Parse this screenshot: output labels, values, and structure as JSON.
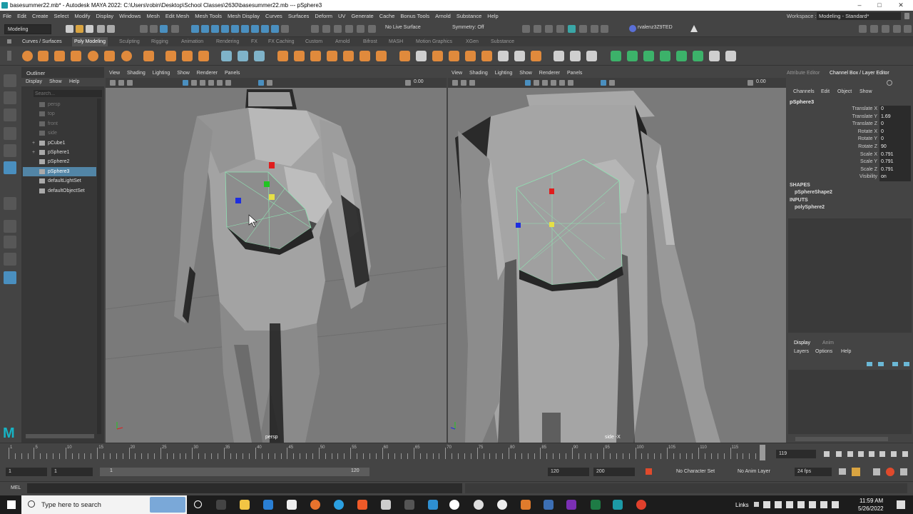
{
  "titlebar": {
    "title": "basesummer22.mb* - Autodesk MAYA 2022: C:\\Users\\robin\\Desktop\\School Classes\\2630\\basesummer22.mb   ---   pSphere3"
  },
  "menubar": {
    "items": [
      "File",
      "Edit",
      "Create",
      "Select",
      "Modify",
      "Display",
      "Windows",
      "Mesh",
      "Edit Mesh",
      "Mesh Tools",
      "Mesh Display",
      "Curves",
      "Surfaces",
      "Deform",
      "UV",
      "Generate",
      "Cache",
      "Bonus Tools",
      "Arnold",
      "Substance",
      "Help"
    ],
    "workspace_label": "Workspace :",
    "workspace_value": "Modeling - Standard*"
  },
  "statusline": {
    "mode": "Modeling",
    "live_surface": "No Live Surface",
    "symmetry": "Symmetry: Off",
    "user": "rvalenz3Z9TED"
  },
  "shelf": {
    "tabs": [
      "Curves / Surfaces",
      "Poly Modeling",
      "Sculpting",
      "Rigging",
      "Animation",
      "Rendering",
      "FX",
      "FX Caching",
      "Custom",
      "Arnold",
      "Bifrost",
      "MASH",
      "Motion Graphics",
      "XGen",
      "Substance"
    ],
    "active": "Poly Modeling"
  },
  "outliner": {
    "title": "Outliner",
    "menu": [
      "Display",
      "Show",
      "Help"
    ],
    "search_placeholder": "Search...",
    "items": [
      {
        "label": "persp",
        "dim": true
      },
      {
        "label": "top",
        "dim": true
      },
      {
        "label": "front",
        "dim": true
      },
      {
        "label": "side",
        "dim": true
      },
      {
        "label": "pCube1",
        "dim": false
      },
      {
        "label": "pSphere1",
        "dim": false
      },
      {
        "label": "pSphere2",
        "dim": false
      },
      {
        "label": "pSphere3",
        "dim": false,
        "selected": true
      },
      {
        "label": "defaultLightSet",
        "dim": false
      },
      {
        "label": "defaultObjectSet",
        "dim": false
      }
    ]
  },
  "viewport_left": {
    "menu": [
      "View",
      "Shading",
      "Lighting",
      "Show",
      "Renderer",
      "Panels"
    ],
    "value": "0.00",
    "camera": "persp"
  },
  "viewport_right": {
    "menu": [
      "View",
      "Shading",
      "Lighting",
      "Show",
      "Renderer",
      "Panels"
    ],
    "value": "0.00",
    "camera": "side -X"
  },
  "channelbox": {
    "tabs": [
      "Attribute Editor",
      "Channel Box / Layer Editor"
    ],
    "menu": [
      "Channels",
      "Edit",
      "Object",
      "Show"
    ],
    "object": "pSphere3",
    "attributes": [
      {
        "name": "Translate X",
        "value": "0"
      },
      {
        "name": "Translate Y",
        "value": "1.69"
      },
      {
        "name": "Translate Z",
        "value": "0"
      },
      {
        "name": "Rotate X",
        "value": "0"
      },
      {
        "name": "Rotate Y",
        "value": "0"
      },
      {
        "name": "Rotate Z",
        "value": "90"
      },
      {
        "name": "Scale X",
        "value": "0.791"
      },
      {
        "name": "Scale Y",
        "value": "0.791"
      },
      {
        "name": "Scale Z",
        "value": "0.791"
      },
      {
        "name": "Visibility",
        "value": "on"
      }
    ],
    "shapes_header": "SHAPES",
    "shape": "pSphereShape2",
    "inputs_header": "INPUTS",
    "input": "polySphere2",
    "layer_tabs": [
      "Display",
      "Anim"
    ],
    "layer_menu": [
      "Layers",
      "Options",
      "Help"
    ]
  },
  "timeline": {
    "ticks": [
      "1",
      "5",
      "10",
      "15",
      "20",
      "25",
      "30",
      "35",
      "40",
      "45",
      "50",
      "55",
      "60",
      "65",
      "70",
      "75",
      "80",
      "85",
      "90",
      "95",
      "100",
      "105",
      "110",
      "115",
      "119"
    ],
    "current_frame": "119",
    "range_start": "1",
    "range_start2": "1",
    "slider_start": "1",
    "slider_end": "120",
    "range_end": "120",
    "anim_end": "200",
    "character_set": "No Character Set",
    "anim_layer": "No Anim Layer",
    "fps": "24 fps"
  },
  "mel": {
    "label": "MEL"
  },
  "taskbar": {
    "search_placeholder": "Type here to search",
    "links": "Links",
    "time": "11:59 AM",
    "date": "5/26/2022"
  }
}
